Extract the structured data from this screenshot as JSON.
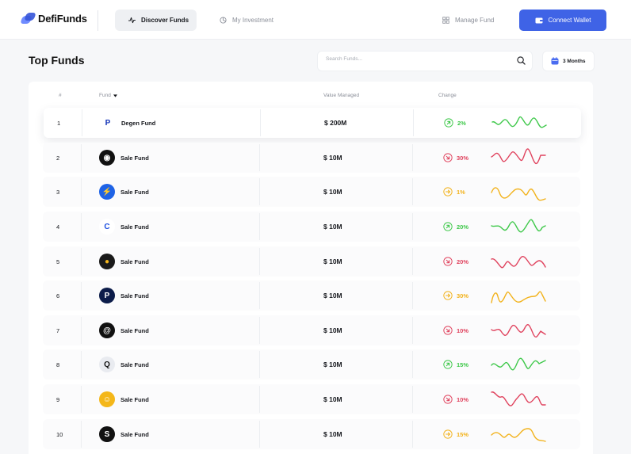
{
  "brand": {
    "name": "DefiFunds"
  },
  "nav": {
    "discover": "Discover Funds",
    "investment": "My Investment",
    "manage": "Manage Fund",
    "connect": "Connect Wallet"
  },
  "page": {
    "title": "Top Funds"
  },
  "search": {
    "placeholder": "Search Funds..."
  },
  "period": {
    "label": "3 Months"
  },
  "table": {
    "headers": {
      "num": "#",
      "fund": "Fund",
      "value": "Value Managed",
      "change": "Change"
    },
    "rows": [
      {
        "num": "1",
        "name": "Degen Fund",
        "value": "$ 200M",
        "change": "2%",
        "trend": "up"
      },
      {
        "num": "2",
        "name": "Sale Fund",
        "value": "$ 10M",
        "change": "30%",
        "trend": "down"
      },
      {
        "num": "3",
        "name": "Sale Fund",
        "value": "$ 10M",
        "change": "1%",
        "trend": "flat"
      },
      {
        "num": "4",
        "name": "Sale Fund",
        "value": "$ 10M",
        "change": "20%",
        "trend": "up"
      },
      {
        "num": "5",
        "name": "Sale Fund",
        "value": "$ 10M",
        "change": "20%",
        "trend": "down"
      },
      {
        "num": "6",
        "name": "Sale Fund",
        "value": "$ 10M",
        "change": "30%",
        "trend": "flat"
      },
      {
        "num": "7",
        "name": "Sale Fund",
        "value": "$ 10M",
        "change": "10%",
        "trend": "down"
      },
      {
        "num": "8",
        "name": "Sale Fund",
        "value": "$ 10M",
        "change": "15%",
        "trend": "up"
      },
      {
        "num": "9",
        "name": "Sale Fund",
        "value": "$ 10M",
        "change": "10%",
        "trend": "down"
      },
      {
        "num": "10",
        "name": "Sale Fund",
        "value": "$ 10M",
        "change": "15%",
        "trend": "flat"
      }
    ]
  },
  "colors": {
    "accent": "#3f63e6",
    "up": "#3ec84a",
    "down": "#e0435e",
    "flat": "#f2b21b"
  },
  "icons": {
    "discover": "activity-icon",
    "investment": "pie-chart-icon",
    "manage": "grid-icon",
    "connect": "wallet-icon",
    "search": "search-icon",
    "period": "calendar-icon",
    "sort": "caret-down-icon"
  }
}
